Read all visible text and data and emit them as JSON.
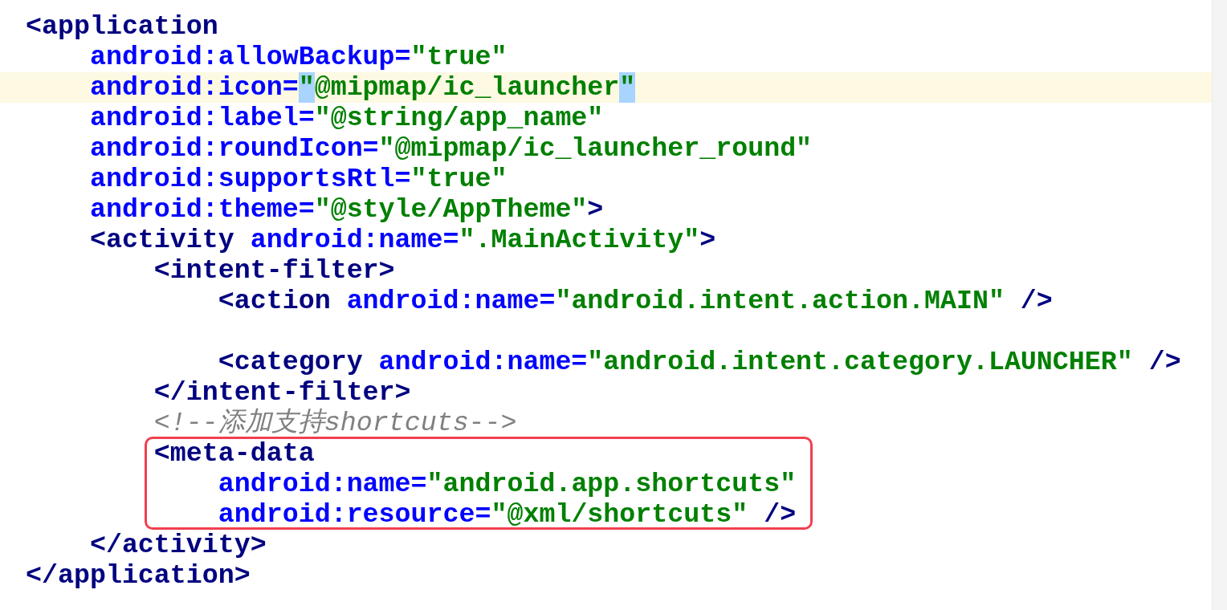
{
  "editor": {
    "lines": [
      {
        "kind": "code",
        "highlighted": false,
        "tokens": [
          {
            "kind": "tag",
            "text": "<application"
          }
        ]
      },
      {
        "kind": "code",
        "highlighted": false,
        "tokens": [
          {
            "kind": "attr",
            "text": "    android:allowBackup="
          },
          {
            "kind": "value",
            "text": "\"true\""
          }
        ]
      },
      {
        "kind": "code",
        "highlighted": true,
        "tokens": [
          {
            "kind": "attr",
            "text": "    android:icon="
          },
          {
            "kind": "match",
            "text": "\""
          },
          {
            "kind": "value",
            "text": "@mipmap/ic_launcher"
          },
          {
            "kind": "match",
            "text": "\""
          }
        ]
      },
      {
        "kind": "code",
        "highlighted": false,
        "tokens": [
          {
            "kind": "attr",
            "text": "    android:label="
          },
          {
            "kind": "value",
            "text": "\"@string/app_name\""
          }
        ]
      },
      {
        "kind": "code",
        "highlighted": false,
        "tokens": [
          {
            "kind": "attr",
            "text": "    android:roundIcon="
          },
          {
            "kind": "value",
            "text": "\"@mipmap/ic_launcher_round\""
          }
        ]
      },
      {
        "kind": "code",
        "highlighted": false,
        "tokens": [
          {
            "kind": "attr",
            "text": "    android:supportsRtl="
          },
          {
            "kind": "value",
            "text": "\"true\""
          }
        ]
      },
      {
        "kind": "code",
        "highlighted": false,
        "tokens": [
          {
            "kind": "attr",
            "text": "    android:theme="
          },
          {
            "kind": "value",
            "text": "\"@style/AppTheme\""
          },
          {
            "kind": "tag",
            "text": ">"
          }
        ]
      },
      {
        "kind": "code",
        "highlighted": false,
        "tokens": [
          {
            "kind": "tag",
            "text": "    <activity"
          },
          {
            "kind": "attr",
            "text": " android:name="
          },
          {
            "kind": "value",
            "text": "\".MainActivity\""
          },
          {
            "kind": "tag",
            "text": ">"
          }
        ]
      },
      {
        "kind": "code",
        "highlighted": false,
        "tokens": [
          {
            "kind": "tag",
            "text": "        <intent-filter>"
          }
        ]
      },
      {
        "kind": "code",
        "highlighted": false,
        "tokens": [
          {
            "kind": "tag",
            "text": "            <action"
          },
          {
            "kind": "attr",
            "text": " android:name="
          },
          {
            "kind": "value",
            "text": "\"android.intent.action.MAIN\""
          },
          {
            "kind": "tag",
            "text": " />"
          }
        ]
      },
      {
        "kind": "blank",
        "highlighted": false
      },
      {
        "kind": "code",
        "highlighted": false,
        "tokens": [
          {
            "kind": "tag",
            "text": "            <category"
          },
          {
            "kind": "attr",
            "text": " android:name="
          },
          {
            "kind": "value",
            "text": "\"android.intent.category.LAUNCHER\""
          },
          {
            "kind": "tag",
            "text": " />"
          }
        ]
      },
      {
        "kind": "code",
        "highlighted": false,
        "tokens": [
          {
            "kind": "tag",
            "text": "        </intent-filter>"
          }
        ]
      },
      {
        "kind": "code",
        "highlighted": false,
        "tokens": [
          {
            "kind": "comment",
            "text": "        <!--添加支持shortcuts-->"
          }
        ]
      },
      {
        "kind": "framed",
        "lines": [
          {
            "kind": "code",
            "highlighted": false,
            "tokens": [
              {
                "kind": "tag",
                "text": "        <meta-data"
              }
            ]
          },
          {
            "kind": "code",
            "highlighted": false,
            "tokens": [
              {
                "kind": "attr",
                "text": "            android:name="
              },
              {
                "kind": "value",
                "text": "\"android.app.shortcuts\""
              }
            ]
          },
          {
            "kind": "code",
            "highlighted": false,
            "tokens": [
              {
                "kind": "attr",
                "text": "            android:resource="
              },
              {
                "kind": "value",
                "text": "\"@xml/shortcuts\""
              },
              {
                "kind": "tag",
                "text": " />"
              }
            ]
          }
        ]
      },
      {
        "kind": "code",
        "highlighted": false,
        "tokens": [
          {
            "kind": "tag",
            "text": "    </activity>"
          }
        ]
      },
      {
        "kind": "code",
        "highlighted": false,
        "tokens": [
          {
            "kind": "tag",
            "text": "</application>"
          }
        ]
      }
    ]
  }
}
